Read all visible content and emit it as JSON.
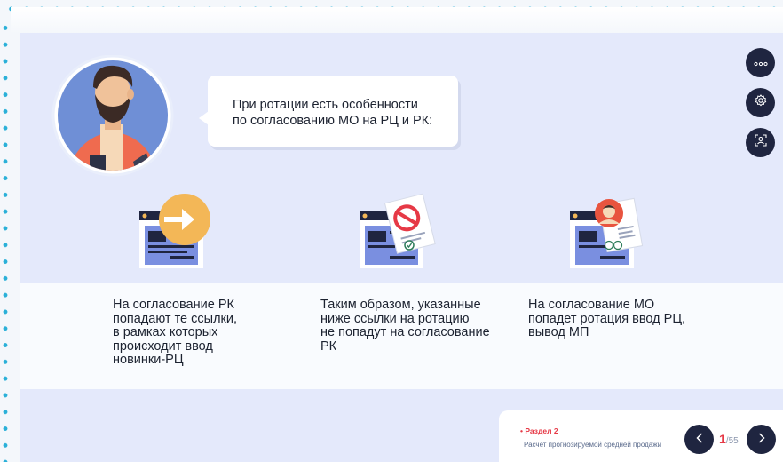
{
  "speech": {
    "text": "При ротации есть особенности\nпо согласованию МО на РЦ и РК:"
  },
  "side_buttons": {
    "more_icon": "more-dots-icon",
    "settings_icon": "gear-icon",
    "accessibility_icon": "user-scan-icon"
  },
  "cards": [
    {
      "text": "На согласование РК\nпопадают те ссылки,\nв рамках которых\nпроисходит ввод\nновинки-РЦ",
      "icon": "browser-arrow-icon"
    },
    {
      "text": "Таким образом, указанные\nниже ссылки на ротацию\nне попадут на согласование\nРК",
      "icon": "browser-forbidden-icon"
    },
    {
      "text": "На согласование МО\nпопадет ротация ввод РЦ,\nвывод МП",
      "icon": "browser-person-doc-icon"
    }
  ],
  "footer": {
    "section_label": "Раздел 2",
    "section_title": "Расчет прогнозируемой средней продажи",
    "current_page": "1",
    "total_pages": "/55"
  },
  "colors": {
    "accent_blue": "#2ab0d8",
    "dark_button": "#1f2540",
    "panel_blue": "#e4e9fb",
    "accent_red": "#e63946",
    "illus_orange": "#f3b757"
  }
}
